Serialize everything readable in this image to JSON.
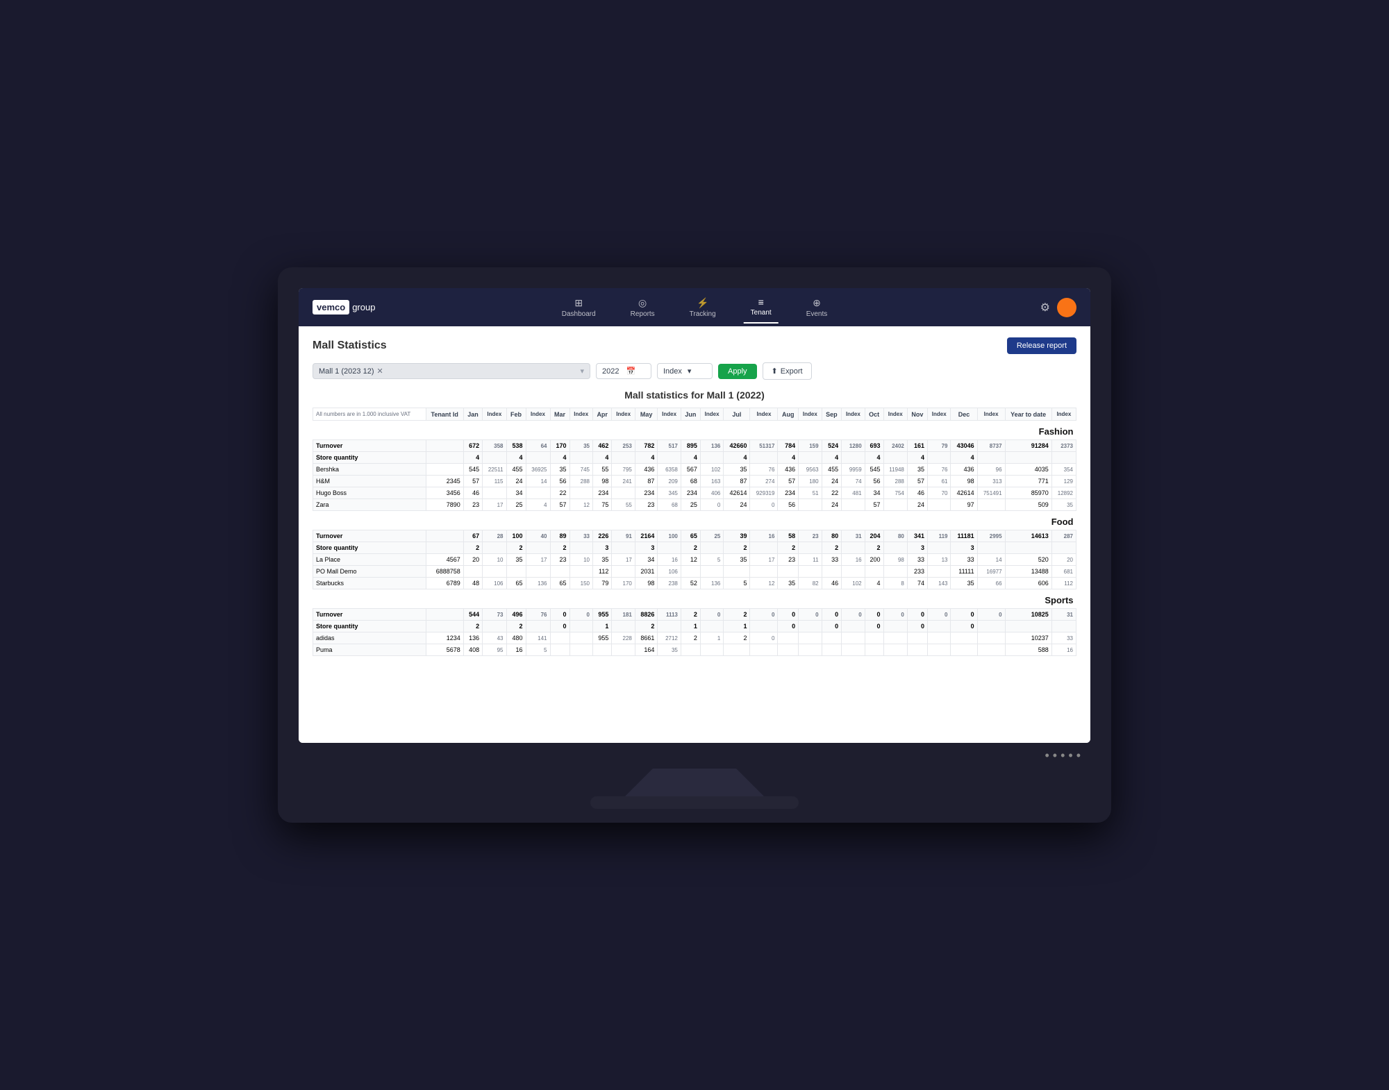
{
  "monitor": {
    "screen_dots": [
      "dot1",
      "dot2",
      "dot3",
      "dot4",
      "dot5"
    ]
  },
  "nav": {
    "logo_vemco": "vemco",
    "logo_group": "group",
    "items": [
      {
        "label": "Dashboard",
        "icon": "⊞",
        "active": false
      },
      {
        "label": "Reports",
        "icon": "⊙",
        "active": false
      },
      {
        "label": "Tracking",
        "icon": "⚡",
        "active": false
      },
      {
        "label": "Tenant",
        "icon": "≡",
        "active": true
      },
      {
        "label": "Events",
        "icon": "⊕",
        "active": false
      }
    ]
  },
  "page": {
    "title": "Mall Statistics",
    "release_btn": "Release report",
    "table_title": "Mall statistics for Mall 1 (2022)",
    "filter_tag": "Mall 1 (2023 12)",
    "year_value": "2022",
    "index_label": "Index",
    "apply_label": "Apply",
    "export_label": "Export",
    "header_note": "All numbers are in 1.000 inclusive VAT"
  },
  "months": [
    "Jan",
    "Feb",
    "Mar",
    "Apr",
    "May",
    "Jun",
    "Jul",
    "Aug",
    "Sep",
    "Oct",
    "Nov",
    "Dec",
    "Year to date"
  ],
  "fashion": {
    "section_title": "Fashion",
    "turnover": {
      "label": "Turnover",
      "jan": 672,
      "jan_idx": 358,
      "feb": 538,
      "feb_idx": 64,
      "mar": 170,
      "mar_idx": 35,
      "apr": 462,
      "apr_idx": 253,
      "may": 782,
      "may_idx": 517,
      "jun": 895,
      "jun_idx": 136,
      "jul": 42660,
      "jul_idx": 51317,
      "aug": 784,
      "aug_idx": 159,
      "sep": 524,
      "sep_idx": 1280,
      "oct": 693,
      "oct_idx": 2402,
      "nov": 161,
      "nov_idx": 79,
      "dec": 43046,
      "dec_idx": 8737,
      "ytd": 91284,
      "ytd_idx": 2373
    },
    "store_qty": {
      "label": "Store quantity",
      "jan": 4,
      "feb": 4,
      "mar": 4,
      "apr": 4,
      "may": 4,
      "jun": 4,
      "jul": 4,
      "aug": 4,
      "sep": 4,
      "oct": 4,
      "nov": 4,
      "dec": 4
    },
    "stores": [
      {
        "name": "Bershka",
        "id": "",
        "jan": 545,
        "jan_idx": 22511,
        "feb": 455,
        "feb_idx": 36925,
        "mar": 35,
        "mar_idx": 745,
        "apr": 55,
        "apr_idx": 795,
        "may": 436,
        "may_idx": 6358,
        "jun": 567,
        "jun_idx": 102,
        "jul": 35,
        "jul_idx": 76,
        "aug": 436,
        "aug_idx": 9563,
        "sep": 455,
        "sep_idx": 9959,
        "oct": 545,
        "oct_idx": 11948,
        "nov": 35,
        "nov_idx": 76,
        "dec": 436,
        "dec_idx": 96,
        "ytd": 4035,
        "ytd_idx": 354
      },
      {
        "name": "H&M",
        "id": "2345",
        "jan": 57,
        "jan_idx": 115,
        "feb": 24,
        "feb_idx": 14,
        "mar": 56,
        "mar_idx": 288,
        "apr": 98,
        "apr_idx": 241,
        "may": 87,
        "may_idx": 209,
        "jun": 68,
        "jun_idx": 163,
        "jul": 87,
        "jul_idx": 274,
        "aug": 57,
        "aug_idx": 180,
        "sep": 24,
        "sep_idx": 74,
        "oct": 56,
        "oct_idx": 288,
        "nov": 57,
        "nov_idx": 61,
        "dec": 98,
        "dec_idx": 313,
        "ytd": 771,
        "ytd_idx": 129
      },
      {
        "name": "Hugo Boss",
        "id": "3456",
        "jan": 46,
        "jan_idx": "",
        "feb": 34,
        "feb_idx": "",
        "mar": 22,
        "mar_idx": "",
        "apr": 234,
        "apr_idx": "",
        "may": 234,
        "may_idx": 345,
        "jun": 234,
        "jun_idx": 406,
        "jul": 42614,
        "jul_idx": 929319,
        "aug": 234,
        "aug_idx": 51,
        "sep": 22,
        "sep_idx": 481,
        "oct": 34,
        "oct_idx": 754,
        "nov": 46,
        "nov_idx": 70,
        "dec": 42614,
        "dec_idx": 751491,
        "ytd": 85970,
        "ytd_idx": 12892
      },
      {
        "name": "Zara",
        "id": "7890",
        "jan": 23,
        "jan_idx": 17,
        "feb": 25,
        "feb_idx": 4,
        "mar": 57,
        "mar_idx": 12,
        "apr": 75,
        "apr_idx": 55,
        "may": 23,
        "may_idx": 68,
        "jun": 25,
        "jun_idx": 0,
        "jul": 24,
        "jul_idx": 0,
        "aug": 56,
        "aug_idx": "",
        "sep": 24,
        "sep_idx": "",
        "oct": 57,
        "oct_idx": "",
        "nov": 24,
        "nov_idx": "",
        "dec": 97,
        "dec_idx": "",
        "ytd": 509,
        "ytd_idx": 35
      }
    ]
  },
  "food": {
    "section_title": "Food",
    "turnover": {
      "label": "Turnover",
      "jan": 67,
      "jan_idx": 28,
      "feb": 100,
      "feb_idx": 40,
      "mar": 89,
      "mar_idx": 33,
      "apr": 226,
      "apr_idx": 91,
      "may": 2164,
      "may_idx": 100,
      "jun": 65,
      "jun_idx": 25,
      "jul": 39,
      "jul_idx": 16,
      "aug": 58,
      "aug_idx": 23,
      "sep": 80,
      "sep_idx": 31,
      "oct": 204,
      "oct_idx": 80,
      "nov": 341,
      "nov_idx": 119,
      "dec": 11181,
      "dec_idx": 2995,
      "ytd": 14613,
      "ytd_idx": 287
    },
    "store_qty": {
      "label": "Store quantity",
      "jan": 2,
      "feb": 2,
      "mar": 2,
      "apr": 3,
      "may": 3,
      "jun": 2,
      "jul": 2,
      "aug": 2,
      "sep": 2,
      "oct": 2,
      "nov": 3,
      "dec": 3
    },
    "stores": [
      {
        "name": "La Place",
        "id": "4567",
        "jan": 20,
        "jan_idx": 10,
        "feb": 35,
        "feb_idx": 17,
        "mar": 23,
        "mar_idx": 10,
        "apr": 35,
        "apr_idx": 17,
        "may": 34,
        "may_idx": 16,
        "jun": 12,
        "jun_idx": 5,
        "jul": 35,
        "jul_idx": 17,
        "aug": 23,
        "aug_idx": 11,
        "sep": 33,
        "sep_idx": 16,
        "oct": 200,
        "oct_idx": 98,
        "nov": 33,
        "nov_idx": 13,
        "dec": 33,
        "dec_idx": 14,
        "ytd": 520,
        "ytd_idx": 20
      },
      {
        "name": "PO Mall Demo",
        "id": "6888758",
        "jan": "",
        "jan_idx": "",
        "feb": "",
        "feb_idx": "",
        "mar": "",
        "mar_idx": "",
        "apr": 112,
        "apr_idx": "",
        "may": 2031,
        "may_idx": 106,
        "jun": "",
        "jun_idx": "",
        "jul": "",
        "jul_idx": "",
        "aug": "",
        "aug_idx": "",
        "sep": "",
        "sep_idx": "",
        "oct": "",
        "oct_idx": "",
        "nov": 233,
        "nov_idx": "",
        "dec": 11111,
        "dec_idx": 16977,
        "ytd": 13488,
        "ytd_idx": 681
      },
      {
        "name": "Starbucks",
        "id": "6789",
        "jan": 48,
        "jan_idx": 106,
        "feb": 65,
        "feb_idx": 136,
        "mar": 65,
        "mar_idx": 150,
        "apr": 79,
        "apr_idx": 170,
        "may": 98,
        "may_idx": 238,
        "jun": 52,
        "jun_idx": 136,
        "jul": 5,
        "jul_idx": 12,
        "aug": 35,
        "aug_idx": 82,
        "sep": 46,
        "sep_idx": 102,
        "oct": 4,
        "oct_idx": 8,
        "nov": 74,
        "nov_idx": 143,
        "dec": 35,
        "dec_idx": 66,
        "ytd": 606,
        "ytd_idx": 112
      }
    ]
  },
  "sports": {
    "section_title": "Sports",
    "turnover": {
      "label": "Turnover",
      "jan": 544,
      "jan_idx": 73,
      "feb": 496,
      "feb_idx": 76,
      "mar": 0,
      "mar_idx": 0,
      "apr": 955,
      "apr_idx": 181,
      "may": 8826,
      "may_idx": 1113,
      "jun": 2,
      "jun_idx": 0,
      "jul": 2,
      "jul_idx": 0,
      "aug": 0,
      "aug_idx": 0,
      "sep": 0,
      "sep_idx": 0,
      "oct": 0,
      "oct_idx": 0,
      "nov": 0,
      "nov_idx": 0,
      "dec": 0,
      "dec_idx": 0,
      "ytd": 10825,
      "ytd_idx": 31
    },
    "store_qty": {
      "label": "Store quantity",
      "jan": 2,
      "feb": 2,
      "mar": 0,
      "apr": 1,
      "may": 2,
      "jun": 1,
      "jul": 1,
      "aug": 0,
      "sep": 0,
      "oct": 0,
      "nov": 0,
      "dec": 0
    },
    "stores": [
      {
        "name": "adidas",
        "id": "1234",
        "jan": 136,
        "jan_idx": 43,
        "feb": 480,
        "feb_idx": 141,
        "mar": "",
        "mar_idx": "",
        "apr": 955,
        "apr_idx": 228,
        "may": 8661,
        "may_idx": 2712,
        "jun": 2,
        "jun_idx": 1,
        "jul": 2,
        "jul_idx": 0,
        "aug": "",
        "aug_idx": "",
        "sep": "",
        "sep_idx": "",
        "oct": "",
        "oct_idx": "",
        "nov": "",
        "nov_idx": "",
        "dec": "",
        "dec_idx": "",
        "ytd": 10237,
        "ytd_idx": 33
      },
      {
        "name": "Puma",
        "id": "5678",
        "jan": 408,
        "jan_idx": 95,
        "feb": 16,
        "feb_idx": 5,
        "mar": "",
        "mar_idx": "",
        "apr": "",
        "apr_idx": "",
        "may": 164,
        "may_idx": 35,
        "jun": "",
        "jun_idx": "",
        "jul": "",
        "jul_idx": "",
        "aug": "",
        "aug_idx": "",
        "sep": "",
        "sep_idx": "",
        "oct": "",
        "oct_idx": "",
        "nov": "",
        "nov_idx": "",
        "dec": "",
        "dec_idx": "",
        "ytd": 588,
        "ytd_idx": 16
      }
    ]
  }
}
